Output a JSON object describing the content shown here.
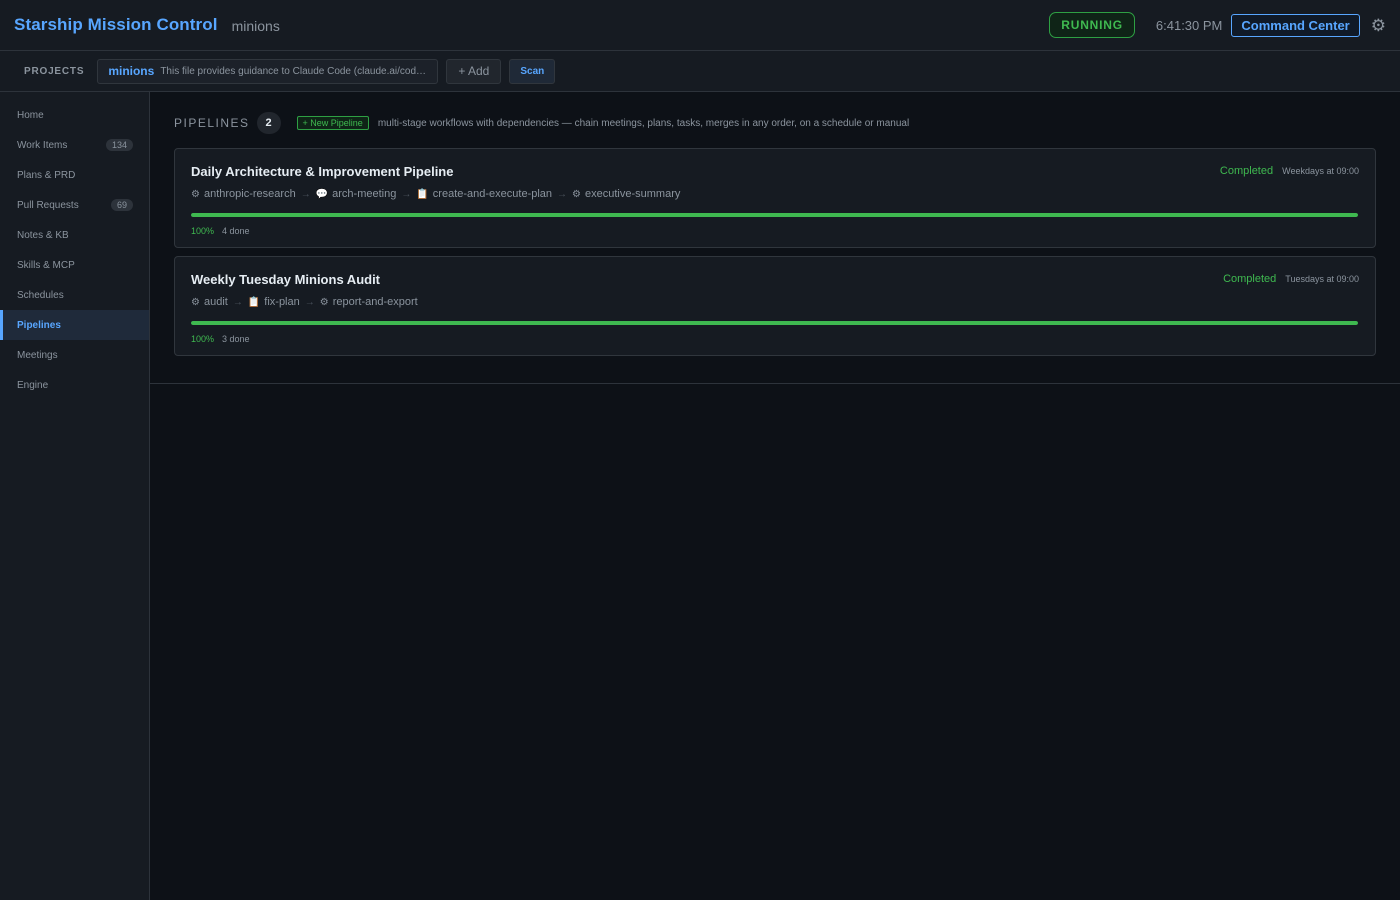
{
  "header": {
    "app_title": "Starship Mission Control",
    "project": "minions",
    "status": "RUNNING",
    "clock": "6:41:30 PM",
    "command_center": "Command Center",
    "settings_icon": "gear-icon"
  },
  "projects_bar": {
    "label": "PROJECTS",
    "active_project": {
      "name": "minions",
      "description": "This file provides guidance to Claude Code (claude.ai/code) ..."
    },
    "add_label": "+ Add",
    "scan_label": "Scan"
  },
  "sidebar": {
    "items": [
      {
        "label": "Home",
        "badge": null
      },
      {
        "label": "Work Items",
        "badge": "134"
      },
      {
        "label": "Plans & PRD",
        "badge": null
      },
      {
        "label": "Pull Requests",
        "badge": "69"
      },
      {
        "label": "Notes & KB",
        "badge": null
      },
      {
        "label": "Skills & MCP",
        "badge": null
      },
      {
        "label": "Schedules",
        "badge": null
      },
      {
        "label": "Pipelines",
        "badge": null
      },
      {
        "label": "Meetings",
        "badge": null
      },
      {
        "label": "Engine",
        "badge": null
      }
    ],
    "active": "Pipelines"
  },
  "pipelines": {
    "title": "PIPELINES",
    "count": "2",
    "new_label": "+ New Pipeline",
    "description": "multi-stage workflows with dependencies — chain meetings, plans, tasks, merges in any order, on a schedule or manual",
    "items": [
      {
        "title": "Daily Architecture & Improvement Pipeline",
        "status": "Completed",
        "schedule": "Weekdays at 09:00",
        "stages": [
          {
            "icon": "⚙",
            "icon_name": "gear-icon",
            "label": "anthropic-research"
          },
          {
            "icon": "💬",
            "icon_name": "speech-bubble-icon",
            "label": "arch-meeting"
          },
          {
            "icon": "📋",
            "icon_name": "clipboard-icon",
            "label": "create-and-execute-plan"
          },
          {
            "icon": "⚙",
            "icon_name": "gear-icon",
            "label": "executive-summary"
          }
        ],
        "progress": 1.0,
        "percent_label": "100%",
        "done_label": "4 done"
      },
      {
        "title": "Weekly Tuesday Minions Audit",
        "status": "Completed",
        "schedule": "Tuesdays at 09:00",
        "stages": [
          {
            "icon": "⚙",
            "icon_name": "gear-icon",
            "label": "audit"
          },
          {
            "icon": "📋",
            "icon_name": "clipboard-icon",
            "label": "fix-plan"
          },
          {
            "icon": "⚙",
            "icon_name": "gear-icon",
            "label": "report-and-export"
          }
        ],
        "progress": 1.0,
        "percent_label": "100%",
        "done_label": "3 done"
      }
    ]
  },
  "colors": {
    "accent": "#58a6ff",
    "success": "#3fb950",
    "background": "#0d1117",
    "panel": "#161b22"
  }
}
